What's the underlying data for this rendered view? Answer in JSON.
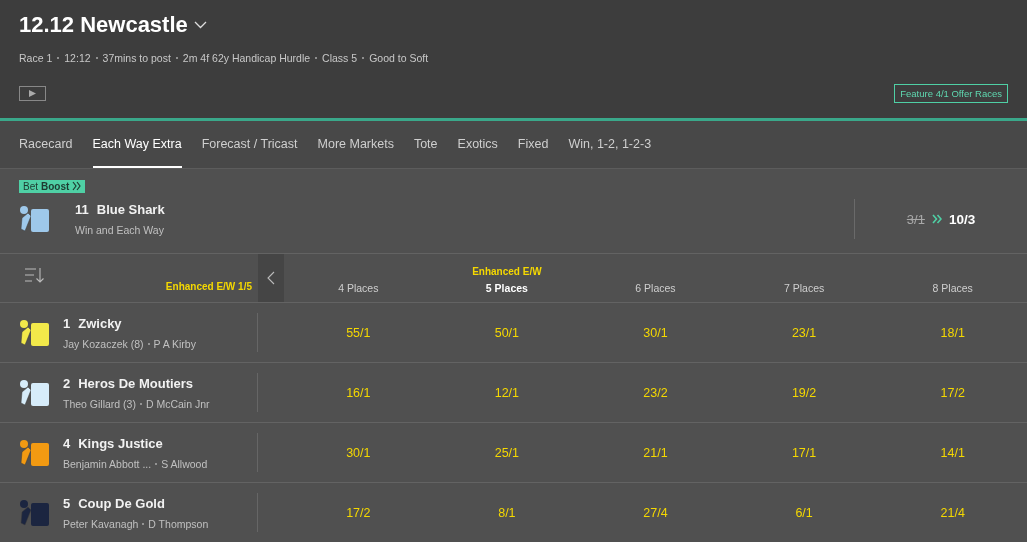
{
  "header": {
    "title": "12.12 Newcastle",
    "info": [
      "Race 1",
      "12:12",
      "37mins to post",
      "2m 4f 62y Handicap Hurdle",
      "Class 5",
      "Good to Soft"
    ],
    "offer_button": "Feature 4/1 Offer Races"
  },
  "tabs": [
    {
      "label": "Racecard",
      "selected": false
    },
    {
      "label": "Each Way Extra",
      "selected": true
    },
    {
      "label": "Forecast / Tricast",
      "selected": false
    },
    {
      "label": "More Markets",
      "selected": false
    },
    {
      "label": "Tote",
      "selected": false
    },
    {
      "label": "Exotics",
      "selected": false
    },
    {
      "label": "Fixed",
      "selected": false
    },
    {
      "label": "Win, 1-2, 1-2-3",
      "selected": false
    }
  ],
  "boost": {
    "badge_plain": "Bet",
    "badge_bold": "Boost",
    "number": "11",
    "name": "Blue Shark",
    "market": "Win and Each Way",
    "was": "3/1",
    "now": "10/3",
    "color": "#9ec8ea"
  },
  "terms": "Enhanced E/W 1/5",
  "columns": [
    {
      "label": "4 Places",
      "selected": false
    },
    {
      "tag": "Enhanced E/W",
      "label": "5 Places",
      "selected": true
    },
    {
      "label": "6 Places",
      "selected": false
    },
    {
      "label": "7 Places",
      "selected": false
    },
    {
      "label": "8 Places",
      "selected": false
    }
  ],
  "runners": [
    {
      "number": "1",
      "name": "Zwicky",
      "jockey": "Jay Kozaczek (8)",
      "trainer": "P A Kirby",
      "color": "#f2e94a",
      "odds": [
        "55/1",
        "50/1",
        "30/1",
        "23/1",
        "18/1"
      ]
    },
    {
      "number": "2",
      "name": "Heros De Moutiers",
      "jockey": "Theo Gillard (3)",
      "trainer": "D McCain Jnr",
      "color": "#d6ecfa",
      "odds": [
        "16/1",
        "12/1",
        "23/2",
        "19/2",
        "17/2"
      ]
    },
    {
      "number": "4",
      "name": "Kings Justice",
      "jockey": "Benjamin Abbott ...",
      "trainer": "S Allwood",
      "color": "#f29a12",
      "odds": [
        "30/1",
        "25/1",
        "21/1",
        "17/1",
        "14/1"
      ]
    },
    {
      "number": "5",
      "name": "Coup De Gold",
      "jockey": "Peter Kavanagh",
      "trainer": "D Thompson",
      "color": "#1b2540",
      "odds": [
        "17/2",
        "8/1",
        "27/4",
        "6/1",
        "21/4"
      ]
    }
  ]
}
